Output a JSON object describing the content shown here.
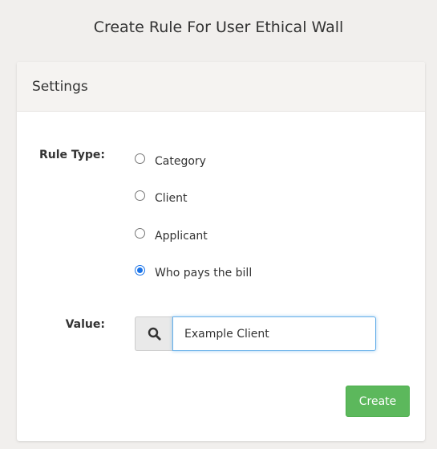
{
  "page": {
    "title": "Create Rule For User Ethical Wall"
  },
  "panel": {
    "header": "Settings"
  },
  "form": {
    "rule_type_label": "Rule Type:",
    "rule_type_options": [
      {
        "label": "Category",
        "checked": false
      },
      {
        "label": "Client",
        "checked": false
      },
      {
        "label": "Applicant",
        "checked": false
      },
      {
        "label": "Who pays the bill",
        "checked": true
      }
    ],
    "value_label": "Value:",
    "value_input": {
      "value": "Example Client",
      "icon": "search-icon"
    },
    "create_button_label": "Create"
  },
  "colors": {
    "background": "#f1efed",
    "panel_header": "#f5f3f1",
    "primary_radio": "#1a73e8",
    "create_button": "#5cb85c",
    "input_focus_border": "#66afe9"
  }
}
